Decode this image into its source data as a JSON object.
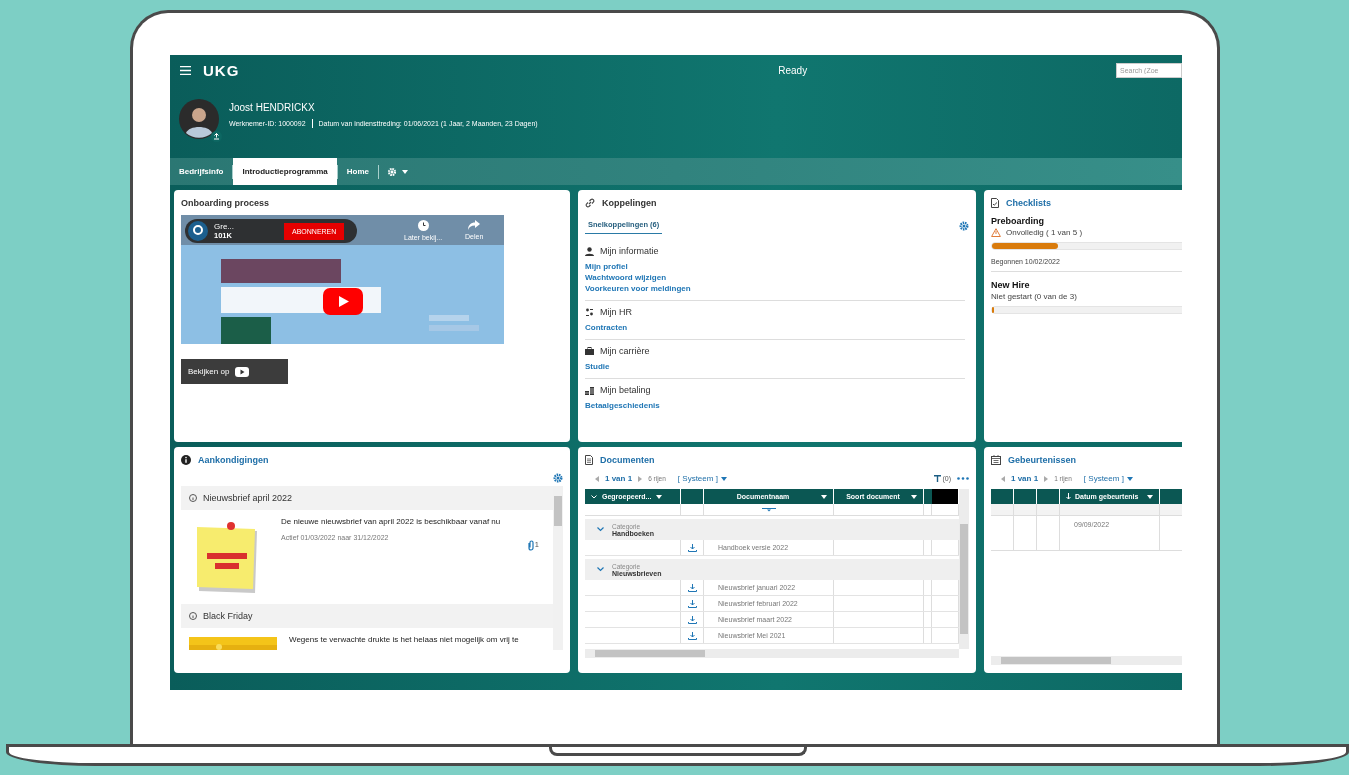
{
  "top_bar": {
    "logo": "UKG",
    "status": "Ready",
    "search": {
      "placeholder": "Search (Zoe"
    }
  },
  "profile": {
    "name": "Joost HENDRICKX",
    "employee_id": "Werknemer-ID: 1000092",
    "start_date": "Datum van indiensttreding: 01/06/2021 (1 Jaar, 2 Maanden, 23 Dagen)"
  },
  "tabs": [
    {
      "label": "Bedrijfsinfo",
      "selected": false
    },
    {
      "label": "Introductieprogramma",
      "selected": true
    },
    {
      "label": "Home",
      "selected": false
    }
  ],
  "onboarding": {
    "title": "Onboarding process",
    "video": {
      "channel": "Gre...",
      "subscribers": "101K",
      "subscribe": "ABONNEREN",
      "watch_later": "Later bekij...",
      "share": "Delen",
      "watch_on": "Bekijken op"
    }
  },
  "links": {
    "title": "Koppelingen",
    "tab": "Snelkoppelingen (6)",
    "sections": [
      {
        "kind": "person",
        "title": "Mijn informatie",
        "links": [
          "Mijn profiel",
          "Wachtwoord wijzigen",
          "Voorkeuren voor meldingen"
        ]
      },
      {
        "kind": "hr",
        "title": "Mijn HR",
        "links": [
          "Contracten"
        ]
      },
      {
        "kind": "briefcase",
        "title": "Mijn carrière",
        "links": [
          "Studie"
        ]
      },
      {
        "kind": "coins",
        "title": "Mijn betaling",
        "links": [
          "Betaalgeschiedenis"
        ]
      }
    ]
  },
  "checklists": {
    "title": "Checklists",
    "items": [
      {
        "name": "Preboarding",
        "status": "Onvolledig ( 1 van 5 )",
        "warning": true,
        "level": 0.27,
        "started": "Begonnen 10/02/2022"
      },
      {
        "name": "New Hire",
        "status": "Niet gestart (0 van de 3)",
        "warning": false,
        "level": 0
      }
    ]
  },
  "announcements": {
    "title": "Aankondigingen",
    "items": [
      {
        "title": "Nieuwsbrief april 2022",
        "text": "De nieuwe nieuwsbrief van april 2022 is beschikbaar vanaf nu",
        "active": "Actief 01/03/2022 naar 31/12/2022",
        "attachments": "1"
      },
      {
        "title": "Black Friday",
        "text": "Wegens te verwachte drukte is het helaas niet mogelijk om vrij te"
      }
    ]
  },
  "documents": {
    "title": "Documenten",
    "pager": "1 van 1",
    "rows_count": "6 rijen",
    "view": "[ Systeem ]",
    "filter": "(0)",
    "columns": [
      "Gegroepeerd...",
      "Documentnaam",
      "Soort document"
    ],
    "groups": [
      {
        "label": "Categorie",
        "name": "Handboeken",
        "expanded": true,
        "rows": [
          "Handboek versie 2022"
        ]
      },
      {
        "label": "Categorie",
        "name": "Nieuwsbrieven",
        "expanded": true,
        "rows": [
          "Nieuwsbrief januari 2022",
          "Nieuwsbrief februari 2022",
          "Nieuwsbrief maart 2022",
          "Nieuwsbrief Mei 2021"
        ]
      }
    ]
  },
  "events": {
    "title": "Gebeurtenissen",
    "pager": "1 van 1",
    "rows_count": "1 rijen",
    "view": "[ Systeem ]",
    "column": "Datum gebeurtenis",
    "rows": [
      "09/09/2022"
    ]
  }
}
